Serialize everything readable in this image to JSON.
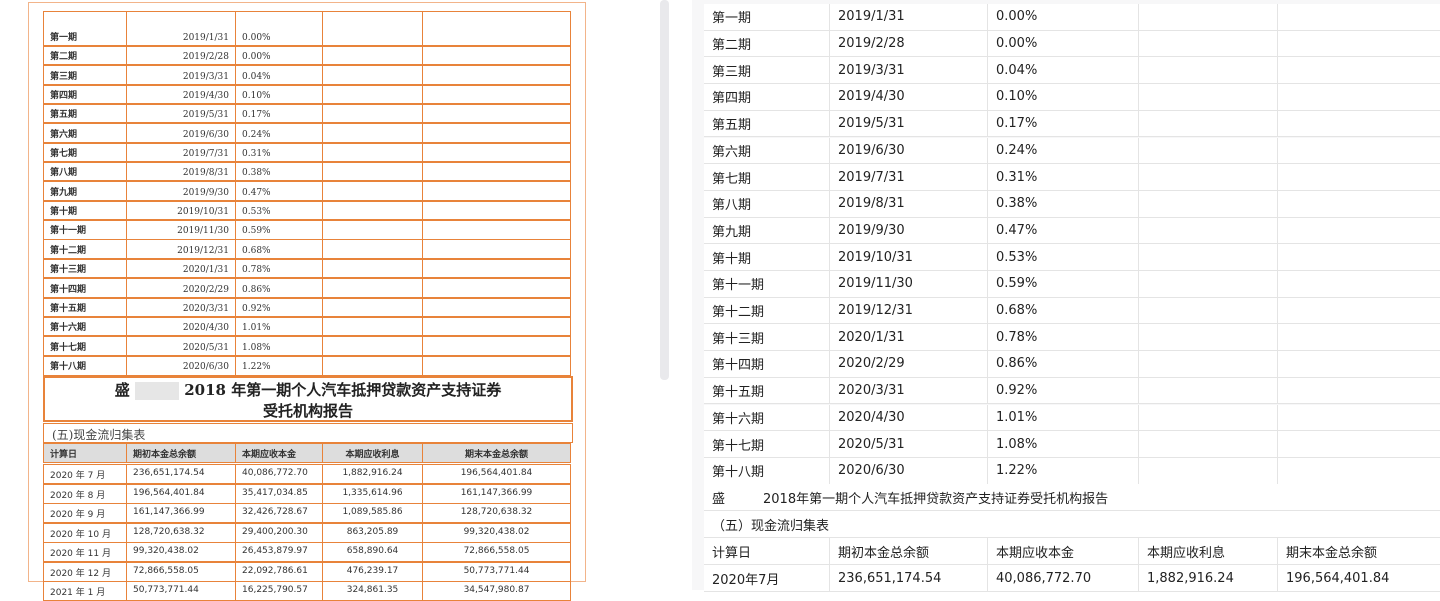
{
  "periods": [
    [
      "第一期",
      "2019/1/31",
      "0.00%"
    ],
    [
      "第二期",
      "2019/2/28",
      "0.00%"
    ],
    [
      "第三期",
      "2019/3/31",
      "0.04%"
    ],
    [
      "第四期",
      "2019/4/30",
      "0.10%"
    ],
    [
      "第五期",
      "2019/5/31",
      "0.17%"
    ],
    [
      "第六期",
      "2019/6/30",
      "0.24%"
    ],
    [
      "第七期",
      "2019/7/31",
      "0.31%"
    ],
    [
      "第八期",
      "2019/8/31",
      "0.38%"
    ],
    [
      "第九期",
      "2019/9/30",
      "0.47%"
    ],
    [
      "第十期",
      "2019/10/31",
      "0.53%"
    ],
    [
      "第十一期",
      "2019/11/30",
      "0.59%"
    ],
    [
      "第十二期",
      "2019/12/31",
      "0.68%"
    ],
    [
      "第十三期",
      "2020/1/31",
      "0.78%"
    ],
    [
      "第十四期",
      "2020/2/29",
      "0.86%"
    ],
    [
      "第十五期",
      "2020/3/31",
      "0.92%"
    ],
    [
      "第十六期",
      "2020/4/30",
      "1.01%"
    ],
    [
      "第十七期",
      "2020/5/31",
      "1.08%"
    ],
    [
      "第十八期",
      "2020/6/30",
      "1.22%"
    ]
  ],
  "report": {
    "prefix": "盛",
    "title_line1": "2018 年第一期个人汽车抵押贷款资产支持证券",
    "title_line2": "受托机构报告",
    "title_parsed": "2018年第一期个人汽车抵押贷款资产支持证券受托机构报告",
    "section": "(五)现金流归集表",
    "section_parsed": "（五）现金流归集表"
  },
  "cashflow": {
    "headers": [
      "计算日",
      "期初本金总余额",
      "本期应收本金",
      "本期应收利息",
      "期末本金总余额"
    ],
    "rows": [
      [
        "2020 年 7 月",
        "236,651,174.54",
        "40,086,772.70",
        "1,882,916.24",
        "196,564,401.84"
      ],
      [
        "2020 年 8 月",
        "196,564,401.84",
        "35,417,034.85",
        "1,335,614.96",
        "161,147,366.99"
      ],
      [
        "2020 年 9 月",
        "161,147,366.99",
        "32,426,728.67",
        "1,089,585.86",
        "128,720,638.32"
      ],
      [
        "2020 年 10 月",
        "128,720,638.32",
        "29,400,200.30",
        "863,205.89",
        "99,320,438.02"
      ],
      [
        "2020 年 11 月",
        "99,320,438.02",
        "26,453,879.97",
        "658,890.64",
        "72,866,558.05"
      ],
      [
        "2020 年 12 月",
        "72,866,558.05",
        "22,092,786.61",
        "476,239.17",
        "50,773,771.44"
      ],
      [
        "2021 年 1 月",
        "50,773,771.44",
        "16,225,790.57",
        "324,861.35",
        "34,547,980.87"
      ]
    ],
    "parsed_first_row": [
      "2020年7月",
      "236,651,174.54",
      "40,086,772.70",
      "1,882,916.24",
      "196,564,401.84"
    ]
  }
}
